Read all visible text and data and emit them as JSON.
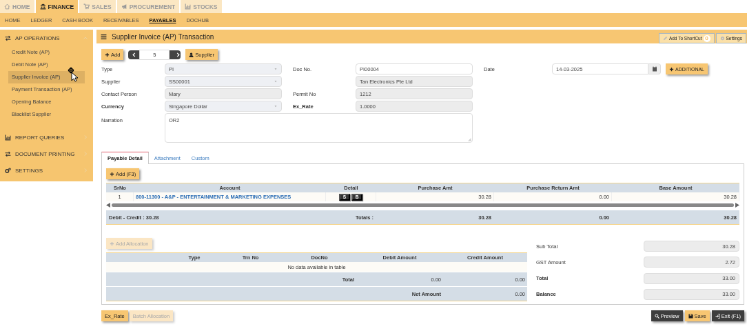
{
  "top_tabs": [
    {
      "label": "HOME",
      "selected": false
    },
    {
      "label": "FINANCE",
      "selected": true
    },
    {
      "label": "SALES",
      "selected": false
    },
    {
      "label": "PROCUREMENT",
      "selected": false
    },
    {
      "label": "STOCKS",
      "selected": false
    }
  ],
  "sub_nav": [
    {
      "label": "HOME",
      "selected": false
    },
    {
      "label": "LEDGER",
      "selected": false
    },
    {
      "label": "CASH BOOK",
      "selected": false
    },
    {
      "label": "RECEIVABLES",
      "selected": false
    },
    {
      "label": "PAYABLES",
      "selected": true
    },
    {
      "label": "DOCHUB",
      "selected": false
    }
  ],
  "sidebar": {
    "sections": [
      {
        "label": "AP OPERATIONS",
        "expanded": true,
        "children": [
          {
            "label": "Credit Note (AP)",
            "selected": false
          },
          {
            "label": "Debit Note (AP)",
            "selected": false
          },
          {
            "label": "Supplier Invoice (AP)",
            "selected": true
          },
          {
            "label": "Payment Transaction (AP)",
            "selected": false
          },
          {
            "label": "Opening Balance",
            "selected": false
          },
          {
            "label": "Blacklist Supplier",
            "selected": false
          }
        ]
      },
      {
        "label": "REPORT QUERIES",
        "expanded": false
      },
      {
        "label": "DOCUMENT PRINTING",
        "expanded": false
      },
      {
        "label": "SETTINGS",
        "expanded": false
      }
    ]
  },
  "panel": {
    "title": "Supplier Invoice (AP) Transaction",
    "shortcut_button": "Add To ShortCut",
    "shortcut_badge": "0",
    "settings_button": "Settings"
  },
  "toolbar": {
    "add_button": "Add",
    "page": "5",
    "supplier_button": "Supplier"
  },
  "form": {
    "rows": [
      [
        {
          "label": "Type",
          "bold": false,
          "kind": "select",
          "value": "PI"
        },
        {
          "label": "Doc No.",
          "bold": false,
          "kind": "input",
          "value": "PI00004"
        },
        {
          "label": "Date",
          "bold": false,
          "kind": "date",
          "value": "14-03-2025"
        }
      ],
      [
        {
          "label": "Supplier",
          "bold": false,
          "kind": "select",
          "value": "SS00001"
        },
        {
          "kind": "readonly",
          "value": "Tan Electronics Pte Ltd"
        }
      ],
      [
        {
          "label": "Contact Person",
          "bold": false,
          "kind": "readonly",
          "value": "Mary"
        },
        {
          "label": "Permit No",
          "bold": false,
          "kind": "readonly",
          "value": "1212"
        }
      ],
      [
        {
          "label": "Currency",
          "bold": true,
          "kind": "select",
          "value": "Singapore Dollar"
        },
        {
          "label": "Ex_Rate",
          "bold": true,
          "kind": "readonly",
          "value": "1.0000"
        }
      ],
      [
        {
          "label": "Narration",
          "bold": false,
          "kind": "textarea",
          "value": "OR2"
        }
      ]
    ],
    "additional_button": "ADDITIONAL"
  },
  "detail_tabs": [
    {
      "label": "Payable Detail",
      "selected": true
    },
    {
      "label": "Attachment",
      "selected": false
    },
    {
      "label": "Custom",
      "selected": false
    }
  ],
  "detail": {
    "add_button": "Add (F3)",
    "columns": [
      "SrNo",
      "Account",
      "Detail",
      "Purchase Amt",
      "Purchase Return Amt",
      "Base Amount"
    ],
    "rows": [
      {
        "srno": "1",
        "account": "800-11300 - A&P - ENTERTAINMENT & MARKETING EXPENSES",
        "badges": [
          "S",
          "B"
        ],
        "purchase_amt": "30.28",
        "return_amt": "0.00",
        "base_amount": "30.28"
      }
    ],
    "footer": {
      "difference": "Debit - Credit : 30.28",
      "totals_label": "Totals :",
      "purchase_amt": "30.28",
      "return_amt": "0.00",
      "base_amount": "30.28"
    }
  },
  "allocation": {
    "add_button": {
      "label": "Add Allocation",
      "disabled": true
    },
    "columns": [
      "Type",
      "Trn No",
      "DocNo",
      "Debit Amount",
      "Credit Amount"
    ],
    "empty_message": "No data available in table",
    "total": {
      "label": "Total",
      "debit": "0.00",
      "credit": "0.00"
    },
    "net": {
      "label": "Net Amount",
      "value": "0.00"
    }
  },
  "summary": [
    {
      "label": "Sub Total",
      "bold": false,
      "value": "30.28"
    },
    {
      "label": "GST Amount",
      "bold": false,
      "value": "2.72"
    },
    {
      "label": "Total",
      "bold": true,
      "value": "33.00"
    },
    {
      "label": "Balance",
      "bold": true,
      "value": "33.00"
    }
  ],
  "bottom_left": [
    {
      "label": "Ex_Rate",
      "disabled": false
    },
    {
      "label": "Batch Allocation",
      "disabled": true
    }
  ],
  "bottom_right": [
    {
      "label": "Preview",
      "kind": "dark"
    },
    {
      "label": "Save",
      "kind": "primary"
    },
    {
      "label": "Exit (F1)",
      "kind": "dark"
    }
  ]
}
